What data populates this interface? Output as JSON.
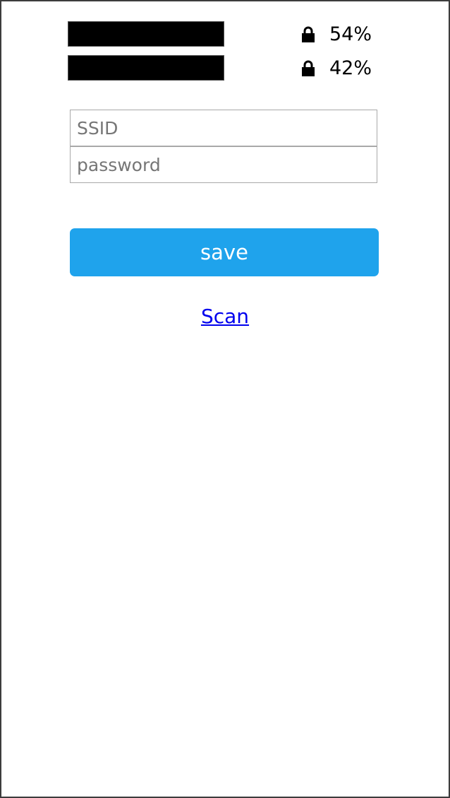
{
  "networks": [
    {
      "ssid": "",
      "secured": true,
      "lock_icon": "lock-icon",
      "signal": "54%"
    },
    {
      "ssid": "",
      "secured": true,
      "lock_icon": "lock-icon",
      "signal": "42%"
    }
  ],
  "form": {
    "ssid_placeholder": "SSID",
    "ssid_value": "",
    "password_placeholder": "password",
    "password_value": "",
    "save_label": "save"
  },
  "scan_label": "Scan",
  "colors": {
    "accent": "#1fa3ec",
    "link": "#0000ee",
    "redaction": "#000000"
  }
}
